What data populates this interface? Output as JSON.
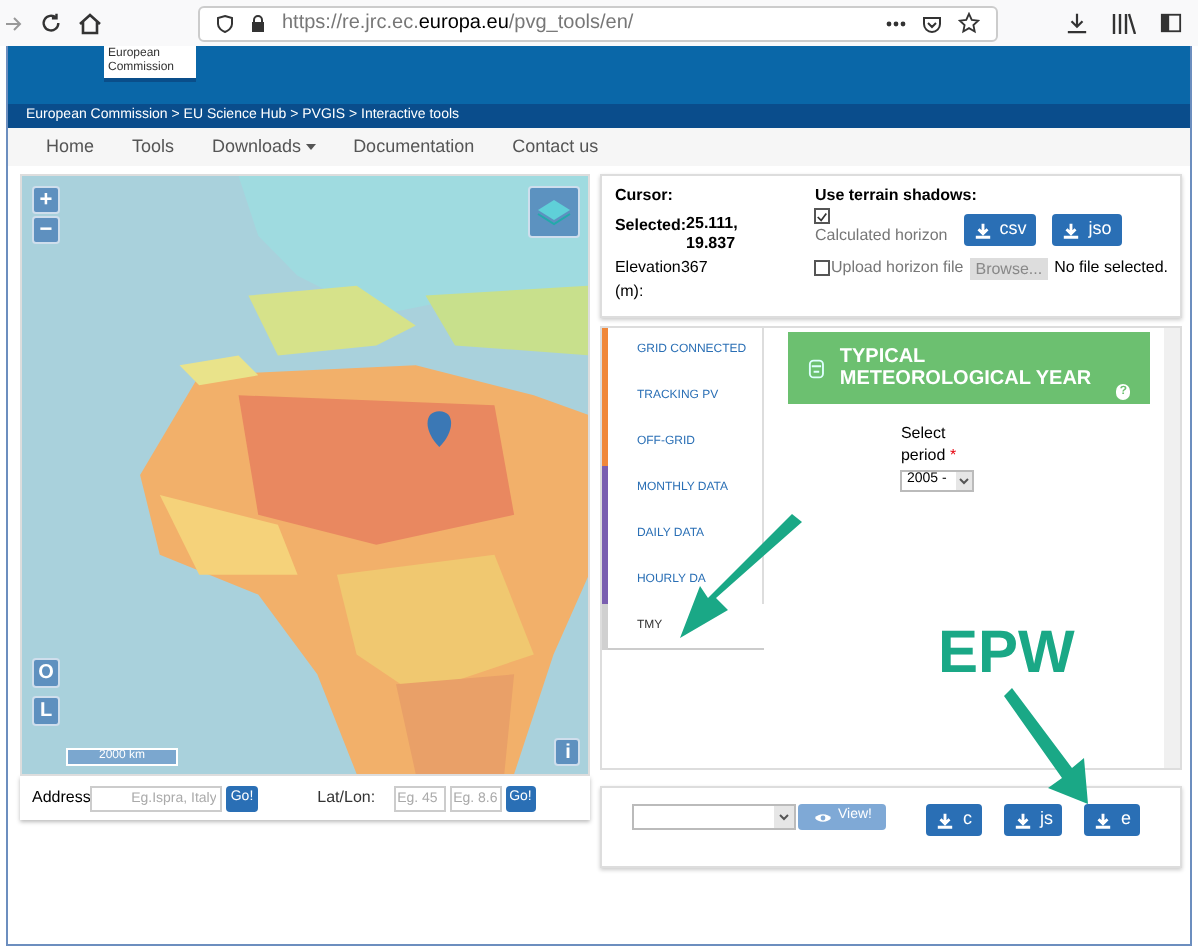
{
  "browser": {
    "url": "https://re.jrc.ec.**europa.eu**/pvg_tools/en/"
  },
  "header": {
    "logo": "European\nCommission",
    "breadcrumb": "European Commission > EU Science Hub > PVGIS > Interactive tools"
  },
  "nav": [
    {
      "label": "Home",
      "dropdown": false
    },
    {
      "label": "Tools",
      "dropdown": false
    },
    {
      "label": "Downloads",
      "dropdown": true
    },
    {
      "label": "Documentation",
      "dropdown": false
    },
    {
      "label": "Contact us",
      "dropdown": false
    }
  ],
  "map": {
    "zoom_in": "+",
    "zoom_out": "−",
    "buttons": [
      "O",
      "L"
    ],
    "scale": "2000 km",
    "info": "i"
  },
  "search": {
    "address_label": "Address",
    "address_placeholder": "Eg.Ispra, Italy",
    "go": "Go!",
    "latlon_label": "Lat/Lon:",
    "lat_placeholder": "Eg. 45",
    "lon_placeholder": "Eg. 8.6",
    "go2": "Go!"
  },
  "cursor": {
    "title": "Cursor:",
    "selected_label": "Selected:",
    "selected_value": "25.111,\n19.837",
    "elevation_label": "Elevation (m):",
    "elevation_value": "367"
  },
  "terrain": {
    "title": "Use terrain shadows:",
    "calculated": {
      "label": "Calculated horizon",
      "checked": true
    },
    "downloads": [
      "csv",
      "jso"
    ],
    "upload": {
      "label": "Upload horizon file",
      "checked": false
    },
    "browse": "Browse...",
    "file_status": "No file selected."
  },
  "tabs": [
    {
      "label": "GRID CONNECTED",
      "color": "#f0883a",
      "selected": false
    },
    {
      "label": "TRACKING PV",
      "color": "#f0883a",
      "selected": false
    },
    {
      "label": "OFF-GRID",
      "color": "#f0883a",
      "selected": false
    },
    {
      "label": "MONTHLY DATA",
      "color": "#7a5fb0",
      "selected": false
    },
    {
      "label": "DAILY DATA",
      "color": "#7a5fb0",
      "selected": false
    },
    {
      "label": "HOURLY DA",
      "color": "#7a5fb0",
      "selected": false
    },
    {
      "label": "TMY",
      "color": "#d0d0d0",
      "selected": true
    }
  ],
  "tmy": {
    "title": "TYPICAL METEOROLOGICAL YEAR",
    "help": "?",
    "period_label": "Select period",
    "required": "*",
    "period_value": "2005 -"
  },
  "output": {
    "view": "View!",
    "downloads": [
      "c",
      "js",
      "e"
    ]
  },
  "annotation": {
    "text": "EPW"
  }
}
